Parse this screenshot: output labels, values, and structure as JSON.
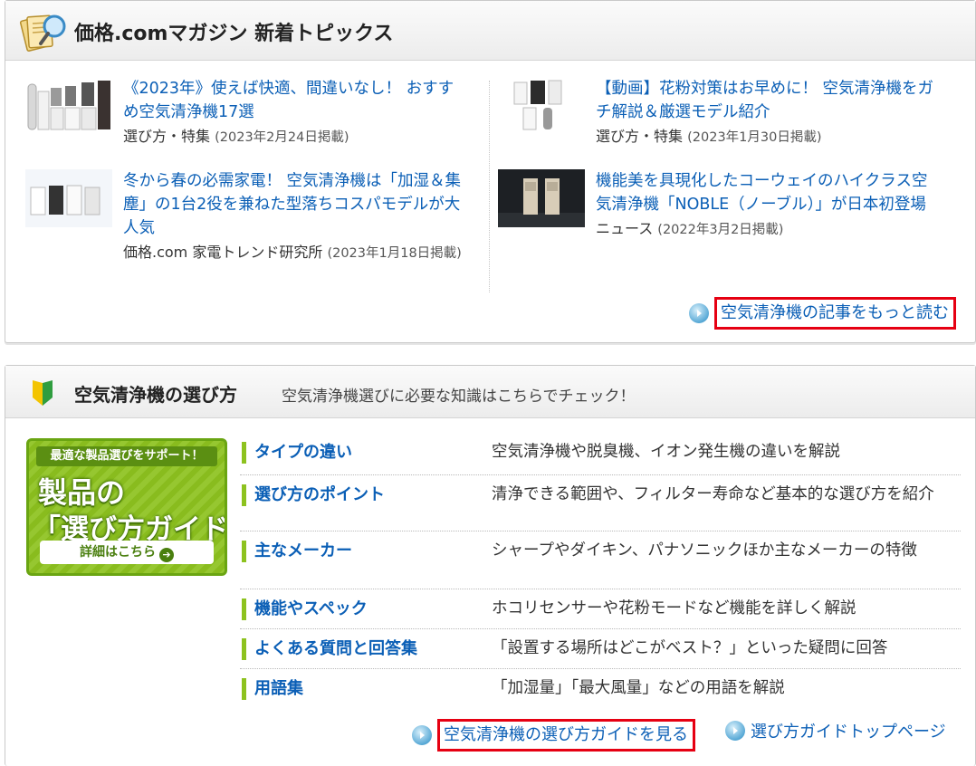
{
  "topics": {
    "title": "価格.comマガジン 新着トピックス",
    "articles": [
      {
        "title": "《2023年》使えば快適、間違いなし！ おすすめ空気清浄機17選",
        "category": "選び方・特集",
        "date": "(2023年2月24日掲載)"
      },
      {
        "title": "【動画】花粉対策はお早めに！ 空気清浄機をガチ解説＆厳選モデル紹介",
        "category": "選び方・特集",
        "date": "(2023年1月30日掲載)"
      },
      {
        "title": "冬から春の必需家電！ 空気清浄機は「加湿＆集塵」の1台2役を兼ねた型落ちコスパモデルが大人気",
        "category": "価格.com 家電トレンド研究所",
        "date": "(2023年1月18日掲載)"
      },
      {
        "title": "機能美を具現化したコーウェイのハイクラス空気清浄機「NOBLE（ノーブル）」が日本初登場",
        "category": "ニュース",
        "date": "(2022年3月2日掲載)"
      }
    ],
    "more_link": "空気清浄機の記事をもっと読む"
  },
  "guide": {
    "title": "空気清浄機の選び方",
    "subtitle": "空気清浄機選びに必要な知識はこちらでチェック！",
    "banner": {
      "top": "最適な製品選びをサポート！",
      "line1": "製品の",
      "line2": "「選び方ガイド」",
      "button": "詳細はこちら",
      "button_icon": "➔"
    },
    "rows": [
      {
        "label": "タイプの違い",
        "desc": "空気清浄機や脱臭機、イオン発生機の違いを解説"
      },
      {
        "label": "選び方のポイント",
        "desc": "清浄できる範囲や、フィルター寿命など基本的な選び方を紹介"
      },
      {
        "label": "主なメーカー",
        "desc": "シャープやダイキン、パナソニックほか主なメーカーの特徴"
      },
      {
        "label": "機能やスペック",
        "desc": "ホコリセンサーや花粉モードなど機能を詳しく解説"
      },
      {
        "label": "よくある質問と回答集",
        "desc": "「設置する場所はどこがベスト？」といった疑問に回答"
      },
      {
        "label": "用語集",
        "desc": "「加湿量」「最大風量」などの用語を解説"
      }
    ],
    "guide_link": "空気清浄機の選び方ガイドを見る",
    "top_link": "選び方ガイドトップページ"
  },
  "colors": {
    "link": "#0b5fb6",
    "highlight_border": "#e60012",
    "guide_green": "#8dc21f"
  }
}
